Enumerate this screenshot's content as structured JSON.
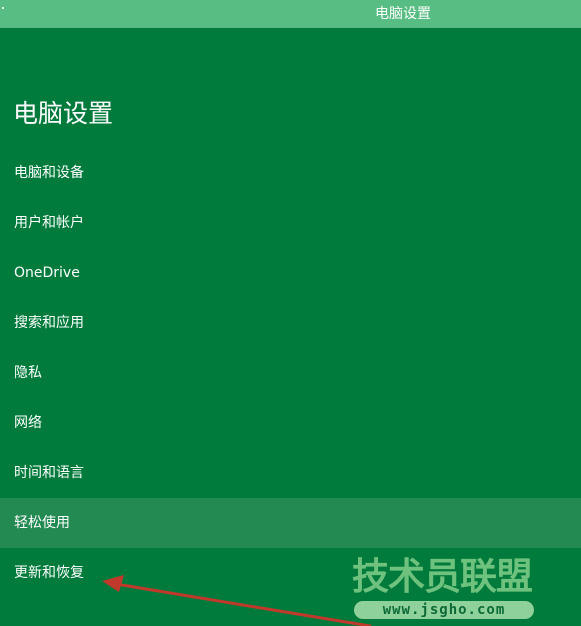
{
  "window": {
    "title": "电脑设置"
  },
  "main": {
    "heading": "电脑设置",
    "nav_items": [
      {
        "label": "电脑和设备",
        "selected": false
      },
      {
        "label": "用户和帐户",
        "selected": false
      },
      {
        "label": "OneDrive",
        "selected": false
      },
      {
        "label": "搜索和应用",
        "selected": false
      },
      {
        "label": "隐私",
        "selected": false
      },
      {
        "label": "网络",
        "selected": false
      },
      {
        "label": "时间和语言",
        "selected": false
      },
      {
        "label": "轻松使用",
        "selected": true
      },
      {
        "label": "更新和恢复",
        "selected": false
      }
    ]
  },
  "watermark": {
    "title": "技术员联盟",
    "url": "www.jsgho.com"
  },
  "annotation": {
    "arrow_color": "#c0392b",
    "points_to": "更新和恢复"
  },
  "colors": {
    "background": "#017b3c",
    "titlebar": "#58bd83",
    "selected_item": "#238a52",
    "text": "#ffffff"
  }
}
